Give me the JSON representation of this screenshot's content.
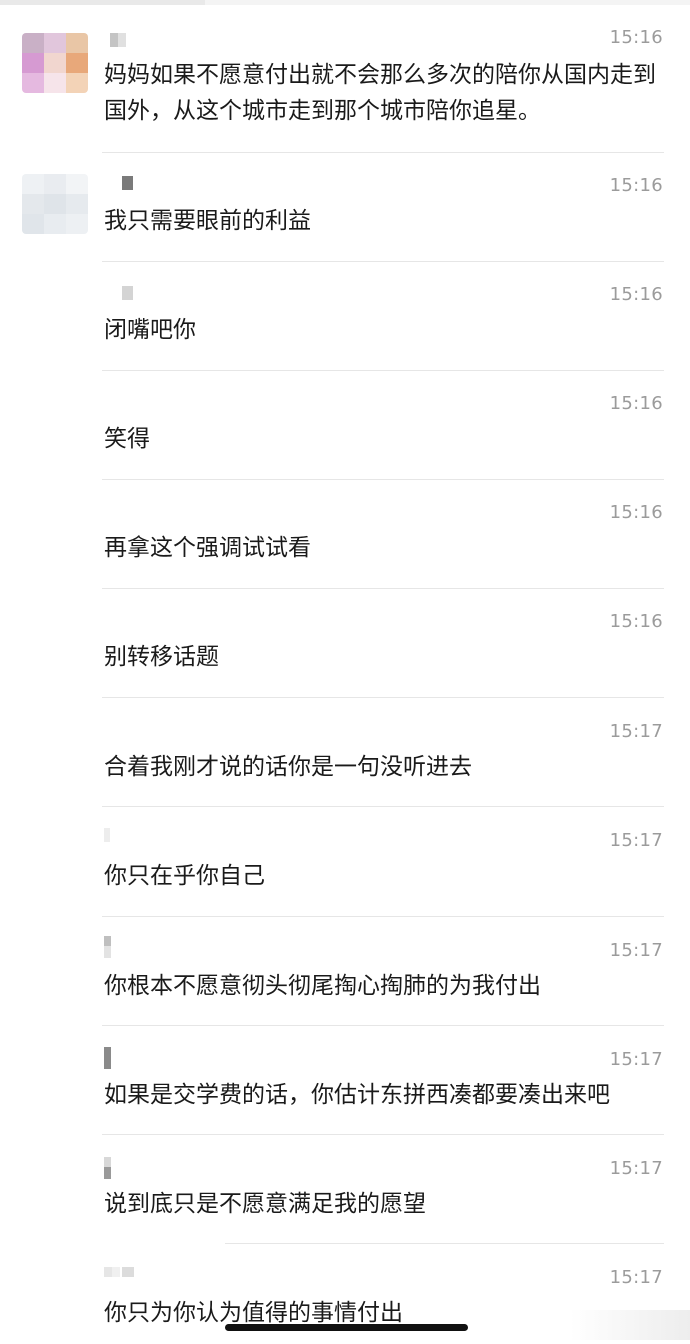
{
  "colors": {
    "text": "#1a1a1a",
    "time": "#9b9b9b",
    "separator": "#e6e6e6",
    "background": "#ffffff"
  },
  "messages": [
    {
      "time": "15:16",
      "text": "妈妈如果不愿意付出就不会那么多次的陪你从国内走到国外，从这个城市走到那个城市陪你追星。"
    },
    {
      "time": "15:16",
      "text": "我只需要眼前的利益"
    },
    {
      "time": "15:16",
      "text": "闭嘴吧你"
    },
    {
      "time": "15:16",
      "text": "笑得"
    },
    {
      "time": "15:16",
      "text": "再拿这个强调试试看"
    },
    {
      "time": "15:16",
      "text": "别转移话题"
    },
    {
      "time": "15:17",
      "text": "合着我刚才说的话你是一句没听进去"
    },
    {
      "time": "15:17",
      "text": "你只在乎你自己"
    },
    {
      "time": "15:17",
      "text": "你根本不愿意彻头彻尾掏心掏肺的为我付出"
    },
    {
      "time": "15:17",
      "text": "如果是交学费的话，你估计东拼西凑都要凑出来吧"
    },
    {
      "time": "15:17",
      "text": "说到底只是不愿意满足我的愿望"
    },
    {
      "time": "15:17",
      "text": "你只为你认为值得的事情付出"
    }
  ]
}
